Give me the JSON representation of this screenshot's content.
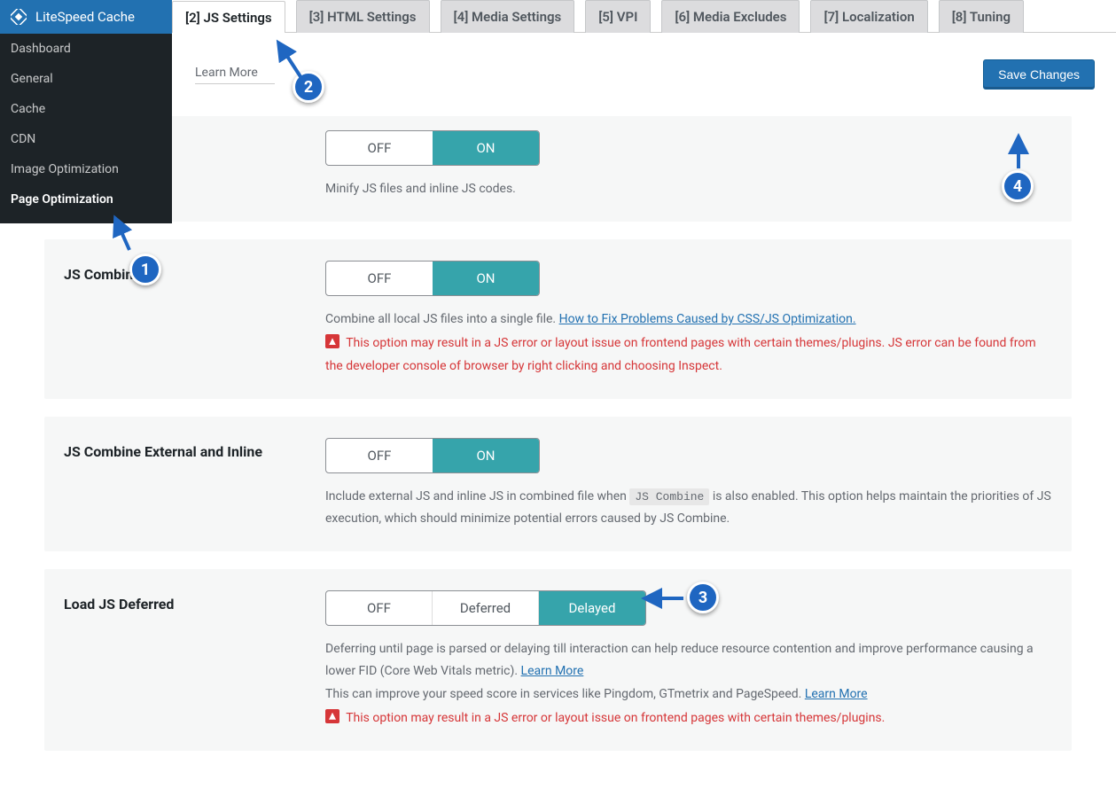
{
  "sidebar": {
    "title": "LiteSpeed Cache",
    "items": [
      {
        "label": "Dashboard"
      },
      {
        "label": "General"
      },
      {
        "label": "Cache"
      },
      {
        "label": "CDN"
      },
      {
        "label": "Image Optimization"
      },
      {
        "label": "Page Optimization"
      }
    ]
  },
  "tabs": [
    {
      "label": "[2] JS Settings"
    },
    {
      "label": "[3] HTML Settings"
    },
    {
      "label": "[4] Media Settings"
    },
    {
      "label": "[5] VPI"
    },
    {
      "label": "[6] Media Excludes"
    },
    {
      "label": "[7] Localization"
    },
    {
      "label": "[8] Tuning"
    }
  ],
  "top": {
    "learn_more": "Learn More",
    "save": "Save Changes"
  },
  "sections": {
    "minify": {
      "off": "OFF",
      "on": "ON",
      "desc": "Minify JS files and inline JS codes."
    },
    "combine": {
      "title": "JS Combine",
      "off": "OFF",
      "on": "ON",
      "desc_pre": "Combine all local JS files into a single file. ",
      "desc_link": "How to Fix Problems Caused by CSS/JS Optimization.",
      "warn": " This option may result in a JS error or layout issue on frontend pages with certain themes/plugins. JS error can be found from the developer console of browser by right clicking and choosing Inspect."
    },
    "external": {
      "title": "JS Combine External and Inline",
      "off": "OFF",
      "on": "ON",
      "desc_pre": "Include external JS and inline JS in combined file when ",
      "desc_code": "JS Combine",
      "desc_post": " is also enabled. This option helps maintain the priorities of JS execution, which should minimize potential errors caused by JS Combine."
    },
    "deferred": {
      "title": "Load JS Deferred",
      "off": "OFF",
      "deferred": "Deferred",
      "delayed": "Delayed",
      "desc1_pre": "Deferring until page is parsed or delaying till interaction can help reduce resource contention and improve performance causing a lower FID (Core Web Vitals metric). ",
      "desc1_link": "Learn More",
      "desc2_pre": "This can improve your speed score in services like Pingdom, GTmetrix and PageSpeed. ",
      "desc2_link": "Learn More",
      "warn": " This option may result in a JS error or layout issue on frontend pages with certain themes/plugins."
    }
  },
  "markers": {
    "1": "1",
    "2": "2",
    "3": "3",
    "4": "4"
  }
}
